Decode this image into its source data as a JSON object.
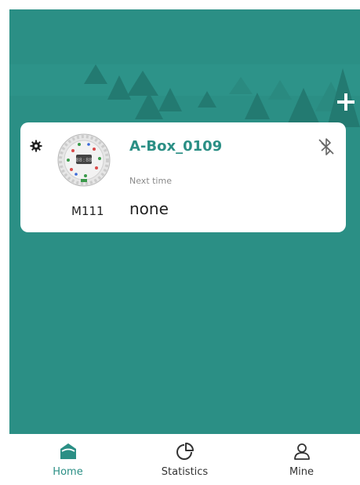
{
  "header": {
    "add_icon": "plus-icon"
  },
  "device_card": {
    "settings_icon": "gear-icon",
    "bluetooth_icon": "bluetooth-off-icon",
    "name": "A-Box_0109",
    "model": "M111",
    "next_time_label": "Next time",
    "next_time_value": "none"
  },
  "tabs": [
    {
      "label": "Home",
      "icon": "home-icon",
      "active": true
    },
    {
      "label": "Statistics",
      "icon": "pie-chart-icon",
      "active": false
    },
    {
      "label": "Mine",
      "icon": "user-icon",
      "active": false
    }
  ],
  "colors": {
    "brand": "#2b8f85",
    "card": "#ffffff",
    "tab_active": "#2b8f85"
  }
}
